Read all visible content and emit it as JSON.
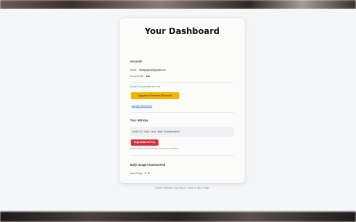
{
  "page": {
    "title": "Your Dashboard"
  },
  "account": {
    "heading": "Account",
    "email_label": "Email:",
    "email_value": "thanlpaigrant@gmail.com",
    "plan_label": "Current Plan:",
    "plan_value": "free",
    "limit_text": "Default 30 summaries per day!",
    "upgrade_button": "Upgrade to Premium ($5/month)",
    "manage_link": "Manage Subscription"
  },
  "api": {
    "heading": "Your API Key",
    "key_value": "d4b8c718-e08d-4ba5-8806-9e0000e9aa67",
    "regenerate_button": "Regenerate API Key",
    "warning": "Warning: Regenerating will disable your old key immediately."
  },
  "usage": {
    "heading": "Daily Usage (Summaries)",
    "used_label": "Used Today:",
    "used_value": "0 / 5"
  },
  "footer": {
    "feedback": "Submit Feedback / Bug Report",
    "separator": "|",
    "signin": "Back to Sign In Page"
  },
  "colors": {
    "accent_yellow": "#f3b400",
    "danger_red": "#d8303c",
    "link_blue": "#2d6fd6",
    "success_green": "#3aa76d"
  }
}
